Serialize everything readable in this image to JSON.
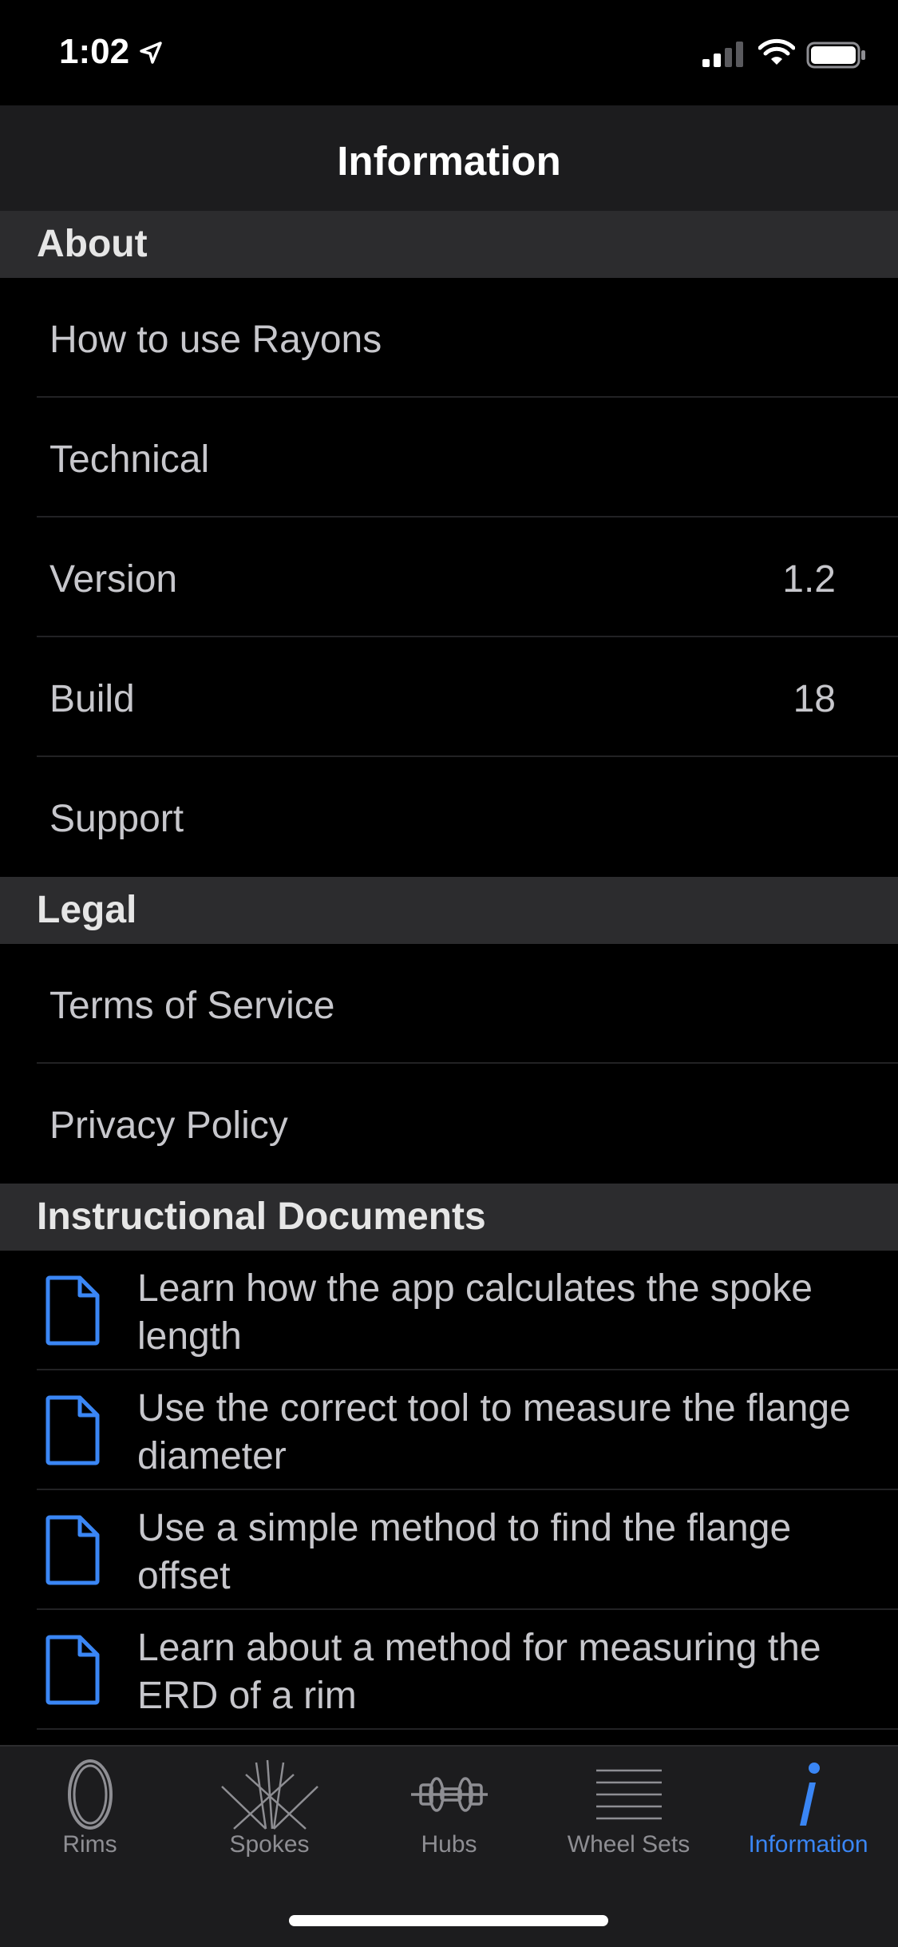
{
  "status": {
    "time": "1:02"
  },
  "nav": {
    "title": "Information"
  },
  "sections": {
    "about": {
      "title": "About",
      "rows": [
        {
          "label": "How to use Rayons",
          "value": ""
        },
        {
          "label": "Technical",
          "value": ""
        },
        {
          "label": "Version",
          "value": "1.2"
        },
        {
          "label": "Build",
          "value": "18"
        },
        {
          "label": "Support",
          "value": ""
        }
      ]
    },
    "legal": {
      "title": "Legal",
      "rows": [
        {
          "label": "Terms of Service"
        },
        {
          "label": "Privacy Policy"
        }
      ]
    },
    "docs": {
      "title": "Instructional Documents",
      "items": [
        {
          "text": "Learn how the app calculates the spoke length",
          "icon": "document-icon"
        },
        {
          "text": "Use the correct tool to measure the flange diameter",
          "icon": "document-icon"
        },
        {
          "text": "Use a simple method to find the flange offset",
          "icon": "document-icon"
        },
        {
          "text": "Learn about a method for measuring the ERD of a rim",
          "icon": "document-icon"
        }
      ]
    }
  },
  "tabs": [
    {
      "label": "Rims",
      "icon": "rim-icon"
    },
    {
      "label": "Spokes",
      "icon": "spokes-icon"
    },
    {
      "label": "Hubs",
      "icon": "hub-icon"
    },
    {
      "label": "Wheel Sets",
      "icon": "wheel-sets-icon"
    },
    {
      "label": "Information",
      "icon": "info-icon",
      "active": true
    }
  ],
  "colors": {
    "accent": "#3a86f5",
    "background": "#000000",
    "header": "#2c2c2e"
  }
}
